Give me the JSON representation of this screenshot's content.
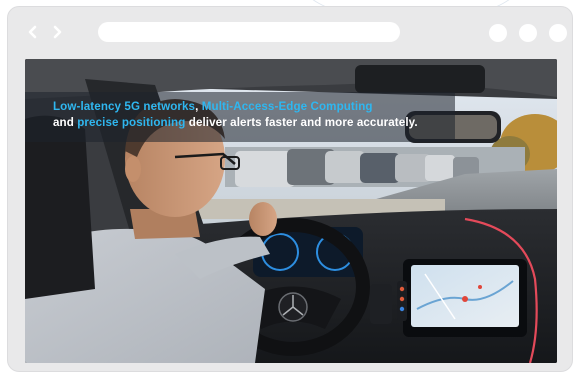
{
  "browser": {
    "back_icon": "chevron-left-icon",
    "forward_icon": "chevron-right-icon",
    "address_value": "",
    "window_controls": [
      "circle",
      "circle",
      "circle"
    ],
    "frame_color": "#e9e9ea"
  },
  "caption": {
    "line1_part1": "Low-latency 5G networks",
    "line1_sep": ", ",
    "line1_part2": "Multi-Access-Edge Computing",
    "line2_part1": "and ",
    "line2_part2": "precise positioning",
    "line2_part3": " deliver alerts faster and more accurately.",
    "highlight_color": "#2fb7f0",
    "text_color": "#ffffff"
  }
}
